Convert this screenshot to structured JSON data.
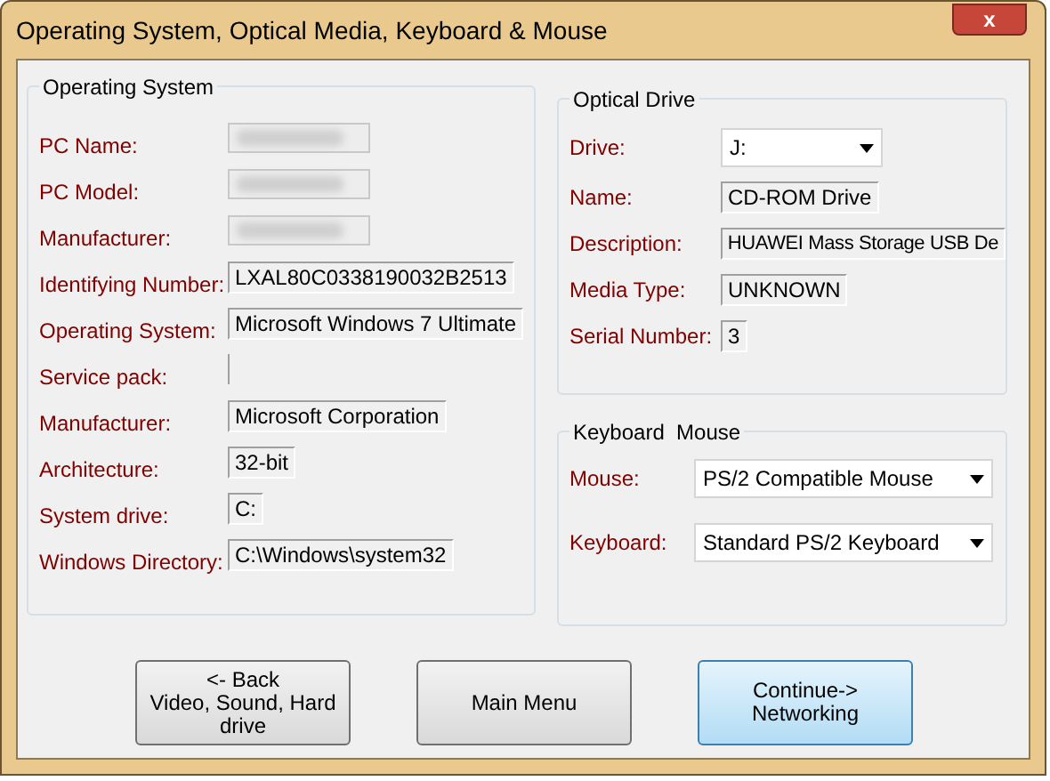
{
  "window": {
    "title": "Operating System, Optical Media, Keyboard & Mouse",
    "close": "x"
  },
  "os_group": {
    "title": "Operating System",
    "rows": [
      {
        "label": "PC Name:",
        "redacted": true
      },
      {
        "label": "PC Model:",
        "redacted": true
      },
      {
        "label": "Manufacturer:",
        "redacted": true
      },
      {
        "label": "Identifying Number:",
        "value": "LXAL80C0338190032B2513"
      },
      {
        "label": "Operating System:",
        "value": "Microsoft Windows 7 Ultimate"
      },
      {
        "label": "Service pack:"
      },
      {
        "label": "Manufacturer:",
        "value": "Microsoft Corporation"
      },
      {
        "label": "Architecture:",
        "value": "32-bit"
      },
      {
        "label": "System drive:",
        "value": "C:"
      },
      {
        "label": "Windows Directory:",
        "value": "C:\\Windows\\system32"
      }
    ]
  },
  "optical_group": {
    "title": "Optical Drive",
    "rows": [
      {
        "kind": "dropdown",
        "label": "Drive:",
        "value": "J:"
      },
      {
        "kind": "field",
        "label": "Name:",
        "value": "CD-ROM Drive"
      },
      {
        "kind": "field",
        "label": "Description:",
        "value": "HUAWEI Mass Storage USB De"
      },
      {
        "kind": "field",
        "label": "Media Type:",
        "value": "UNKNOWN"
      },
      {
        "kind": "field",
        "label": "Serial Number:",
        "value": "3"
      }
    ]
  },
  "input_group": {
    "title": "Keyboard  Mouse",
    "rows": [
      {
        "kind": "dropdown",
        "label": "Mouse:",
        "value": "PS/2 Compatible Mouse"
      },
      {
        "kind": "dropdown",
        "label": "Keyboard:",
        "value": "Standard PS/2 Keyboard"
      }
    ]
  },
  "buttons": [
    {
      "lines": [
        "<- Back",
        "Video, Sound, Hard",
        "drive"
      ],
      "highlighted": false
    },
    {
      "lines": [
        "Main Menu"
      ],
      "highlighted": false
    },
    {
      "lines": [
        "Continue->",
        "Networking"
      ],
      "highlighted": true
    }
  ]
}
